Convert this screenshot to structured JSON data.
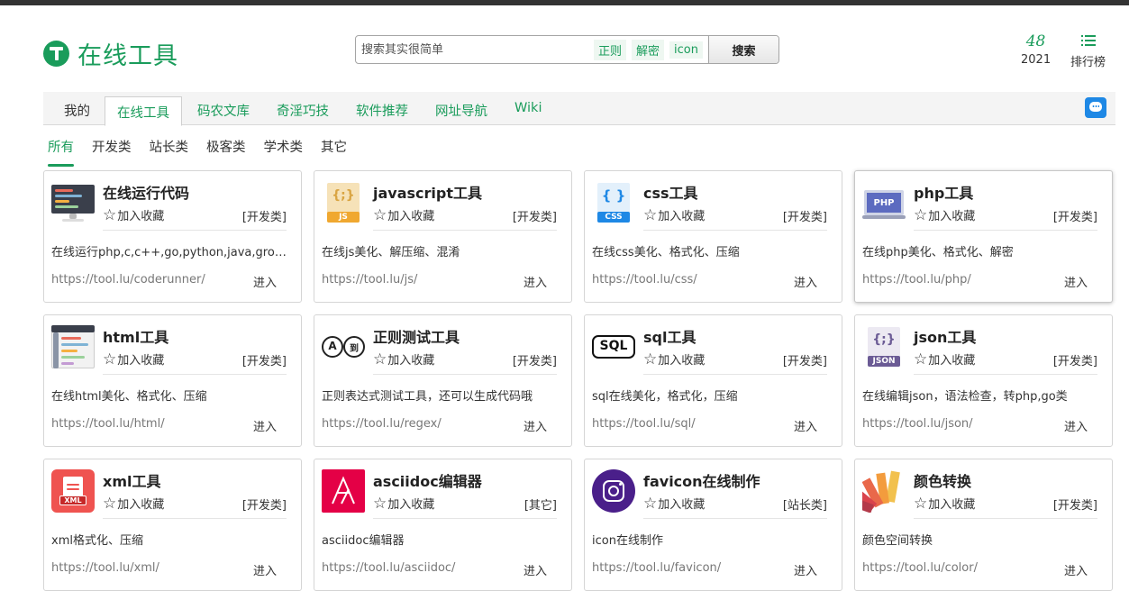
{
  "header": {
    "logo_text": "在线工具",
    "search": {
      "placeholder": "搜索其实很简单",
      "tags": [
        "正则",
        "解密",
        "icon"
      ],
      "button_label": "搜索"
    },
    "stat": {
      "value": "48",
      "label": "2021"
    },
    "ranking_label": "排行榜"
  },
  "nav": {
    "items": [
      "我的",
      "在线工具",
      "码农文库",
      "奇淫巧技",
      "软件推荐",
      "网址导航",
      "Wiki"
    ],
    "active": "在线工具"
  },
  "subnav": {
    "items": [
      "所有",
      "开发类",
      "站长类",
      "极客类",
      "学术类",
      "其它"
    ],
    "active": "所有"
  },
  "favorite_label": "加入收藏",
  "enter_label": "进入",
  "tools": [
    {
      "title": "在线运行代码",
      "category": "[开发类]",
      "desc": "在线运行php,c,c++,go,python,java,groovy...",
      "url": "https://tool.lu/coderunner/",
      "icon": "code-editor-icon"
    },
    {
      "title": "javascript工具",
      "category": "[开发类]",
      "desc": "在线js美化、解压缩、混淆",
      "url": "https://tool.lu/js/",
      "icon": "js-file-icon",
      "badge": "JS"
    },
    {
      "title": "css工具",
      "category": "[开发类]",
      "desc": "在线css美化、格式化、压缩",
      "url": "https://tool.lu/css/",
      "icon": "css-file-icon",
      "badge": "CSS"
    },
    {
      "title": "php工具",
      "category": "[开发类]",
      "desc": "在线php美化、格式化、解密",
      "url": "https://tool.lu/php/",
      "icon": "php-laptop-icon",
      "badge": "PHP"
    },
    {
      "title": "html工具",
      "category": "[开发类]",
      "desc": "在线html美化、格式化、压缩",
      "url": "https://tool.lu/html/",
      "icon": "html-editor-icon"
    },
    {
      "title": "正则测试工具",
      "category": "[开发类]",
      "desc": "正则表达式测试工具，还可以生成代码哦",
      "url": "https://tool.lu/regex/",
      "icon": "regex-translate-icon",
      "badge": "A",
      "badge2": "到"
    },
    {
      "title": "sql工具",
      "category": "[开发类]",
      "desc": "sql在线美化，格式化，压缩",
      "url": "https://tool.lu/sql/",
      "icon": "sql-icon",
      "badge": "SQL"
    },
    {
      "title": "json工具",
      "category": "[开发类]",
      "desc": "在线编辑json，语法检查，转php,go类",
      "url": "https://tool.lu/json/",
      "icon": "json-file-icon",
      "badge": "JSON"
    },
    {
      "title": "xml工具",
      "category": "[开发类]",
      "desc": "xml格式化、压缩",
      "url": "https://tool.lu/xml/",
      "icon": "xml-file-icon",
      "badge": "XML"
    },
    {
      "title": "asciidoc编辑器",
      "category": "[其它]",
      "desc": "asciidoc编辑器",
      "url": "https://tool.lu/asciidoc/",
      "icon": "asciidoc-icon"
    },
    {
      "title": "favicon在线制作",
      "category": "[站长类]",
      "desc": "icon在线制作",
      "url": "https://tool.lu/favicon/",
      "icon": "instagram-style-icon"
    },
    {
      "title": "颜色转换",
      "category": "[开发类]",
      "desc": "颜色空间转换",
      "url": "https://tool.lu/color/",
      "icon": "color-palette-icon"
    }
  ]
}
